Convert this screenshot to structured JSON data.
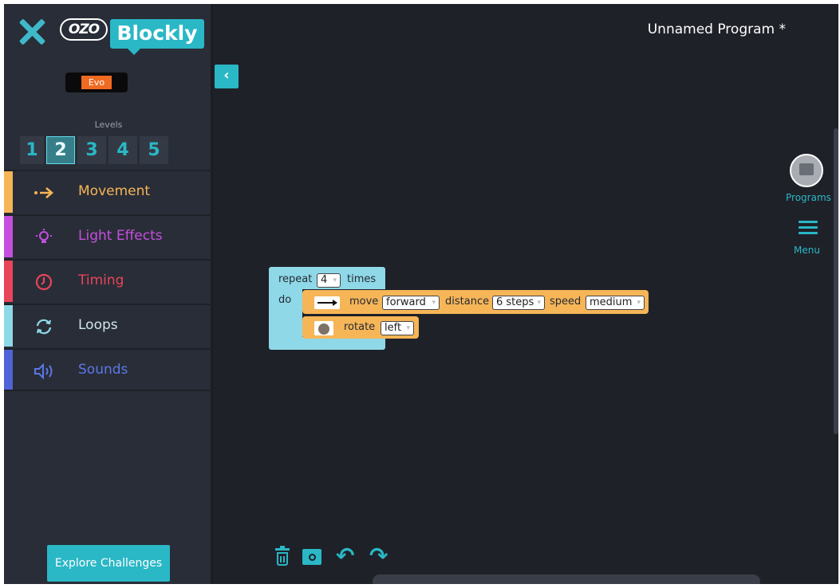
{
  "header": {
    "program_name": "Unnamed Program *",
    "logo_ozo": "OZO",
    "logo_blockly": "Blockly",
    "robot_badge": "Evo"
  },
  "levels": {
    "label": "Levels",
    "items": [
      "1",
      "2",
      "3",
      "4",
      "5"
    ],
    "active": "2"
  },
  "categories": [
    {
      "label": "Movement",
      "icon": "arrow-icon",
      "color": "#f6b557"
    },
    {
      "label": "Light Effects",
      "icon": "bulb-icon",
      "color": "#c64fe0"
    },
    {
      "label": "Timing",
      "icon": "clock-icon",
      "color": "#e8455b"
    },
    {
      "label": "Loops",
      "icon": "loop-icon",
      "color": "#8fd8e8"
    },
    {
      "label": "Sounds",
      "icon": "speaker-icon",
      "color": "#5062d6"
    }
  ],
  "sidebar": {
    "explore_label": "Explore Challenges"
  },
  "toolbar_right": {
    "programs_label": "Programs",
    "menu_label": "Menu"
  },
  "blocks": {
    "repeat": {
      "label": "repeat",
      "count": "4",
      "times": "times",
      "do": "do"
    },
    "move": {
      "label": "move",
      "direction": "forward",
      "distance_label": "distance",
      "distance": "6 steps",
      "speed_label": "speed",
      "speed": "medium"
    },
    "rotate": {
      "label": "rotate",
      "direction": "left"
    }
  },
  "colors": {
    "accent": "#2ab7c6",
    "movement": "#f6b557",
    "loops": "#8fd8e8"
  }
}
